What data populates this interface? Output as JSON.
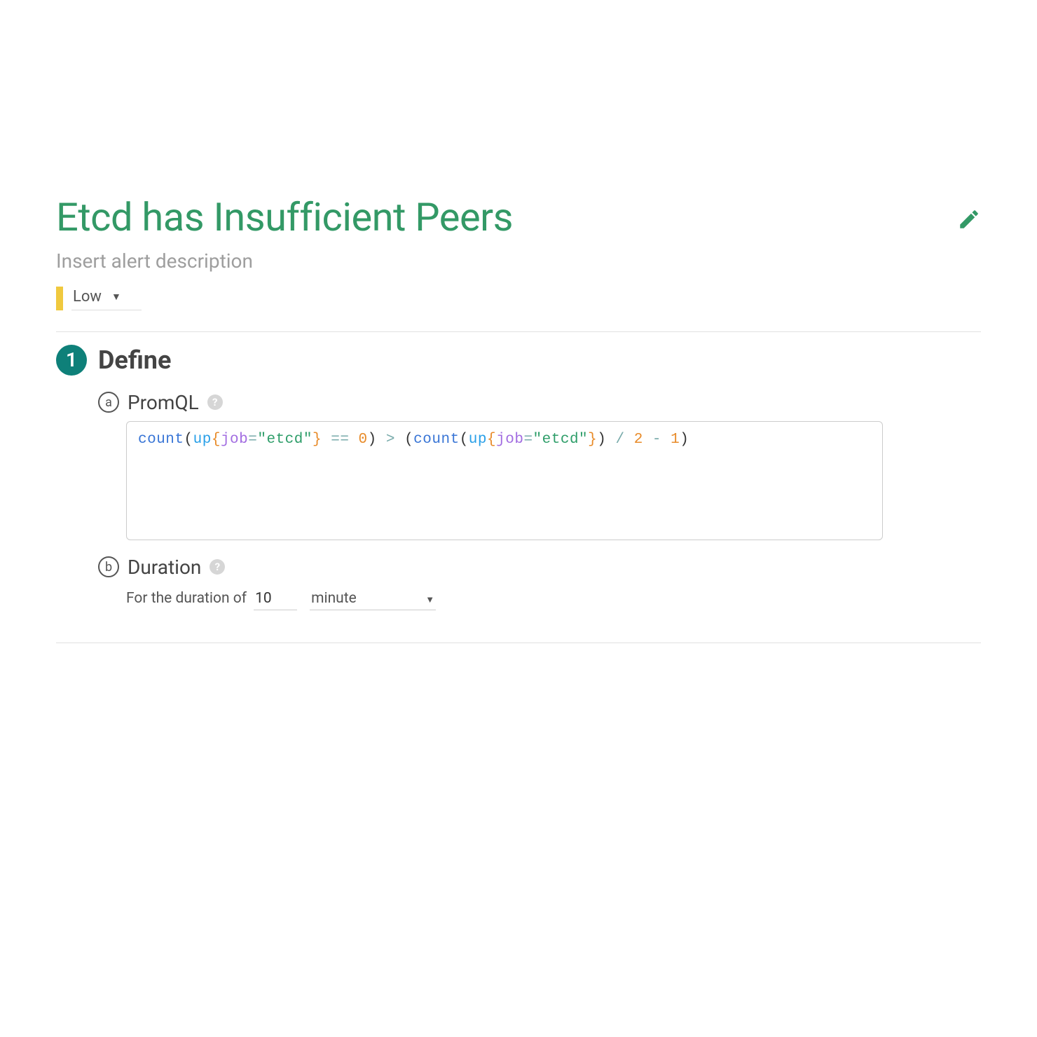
{
  "alert": {
    "title": "Etcd has Insufficient Peers",
    "description_placeholder": "Insert alert description",
    "severity": {
      "label": "Low",
      "color": "#f0c93e"
    }
  },
  "step": {
    "number": "1",
    "title": "Define"
  },
  "promql": {
    "sub_id": "a",
    "label": "PromQL",
    "tokens": [
      {
        "t": "count",
        "c": "c-func"
      },
      {
        "t": "(",
        "c": ""
      },
      {
        "t": "up",
        "c": "c-metric"
      },
      {
        "t": "{",
        "c": "c-brace"
      },
      {
        "t": "job",
        "c": "c-key"
      },
      {
        "t": "=",
        "c": "c-op"
      },
      {
        "t": "\"etcd\"",
        "c": "c-str"
      },
      {
        "t": "}",
        "c": "c-brace"
      },
      {
        "t": " == ",
        "c": "c-op"
      },
      {
        "t": "0",
        "c": "c-num"
      },
      {
        "t": ")",
        "c": ""
      },
      {
        "t": " > ",
        "c": "c-op"
      },
      {
        "t": "(",
        "c": ""
      },
      {
        "t": "count",
        "c": "c-func"
      },
      {
        "t": "(",
        "c": ""
      },
      {
        "t": "up",
        "c": "c-metric"
      },
      {
        "t": "{",
        "c": "c-brace"
      },
      {
        "t": "job",
        "c": "c-key"
      },
      {
        "t": "=",
        "c": "c-op"
      },
      {
        "t": "\"etcd\"",
        "c": "c-str"
      },
      {
        "t": "}",
        "c": "c-brace"
      },
      {
        "t": ")",
        "c": ""
      },
      {
        "t": " / ",
        "c": "c-op"
      },
      {
        "t": "2",
        "c": "c-num"
      },
      {
        "t": " - ",
        "c": "c-op"
      },
      {
        "t": "1",
        "c": "c-num"
      },
      {
        "t": ")",
        "c": ""
      }
    ]
  },
  "duration": {
    "sub_id": "b",
    "label": "Duration",
    "prefix": "For the duration of",
    "value": "10",
    "unit": "minute"
  },
  "glyphs": {
    "help_q": "?"
  }
}
